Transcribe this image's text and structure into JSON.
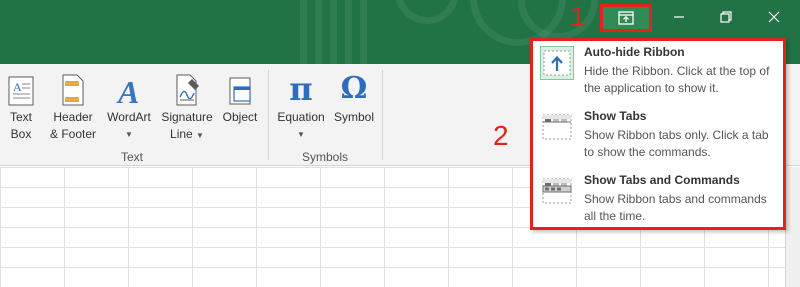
{
  "title_bar": {
    "background": "#217346",
    "minimize_icon": "minimize-icon",
    "restore_icon": "restore-icon",
    "close_icon": "close-icon",
    "ribbon_display_icon": "ribbon-display-options-icon"
  },
  "annotations": {
    "step1": "1",
    "step2": "2",
    "highlight_color": "#e3231b"
  },
  "ribbon": {
    "groups": [
      {
        "label": "Text"
      },
      {
        "label": "Symbols"
      }
    ],
    "buttons": {
      "text_box": {
        "line1": "Text",
        "line2": "Box",
        "icon": "text-box-icon"
      },
      "header_footer": {
        "line1": "Header",
        "line2": "& Footer",
        "icon": "header-footer-icon"
      },
      "wordart": {
        "line1": "WordArt",
        "icon": "wordart-icon"
      },
      "signature_line": {
        "line1": "Signature",
        "line2": "Line",
        "icon": "signature-line-icon"
      },
      "object": {
        "line1": "Object",
        "icon": "object-icon"
      },
      "equation": {
        "line1": "Equation",
        "icon": "pi-icon",
        "glyph": "π"
      },
      "symbol": {
        "line1": "Symbol",
        "icon": "omega-icon",
        "glyph": "Ω"
      }
    }
  },
  "menu": {
    "items": [
      {
        "title": "Auto-hide Ribbon",
        "description": "Hide the Ribbon. Click at the top of the application to show it.",
        "icon": "auto-hide-ribbon-icon"
      },
      {
        "title": "Show Tabs",
        "description": "Show Ribbon tabs only. Click a tab to show the commands.",
        "icon": "show-tabs-icon"
      },
      {
        "title": "Show Tabs and Commands",
        "description": "Show Ribbon tabs and commands all the time.",
        "icon": "show-tabs-commands-icon"
      }
    ]
  }
}
